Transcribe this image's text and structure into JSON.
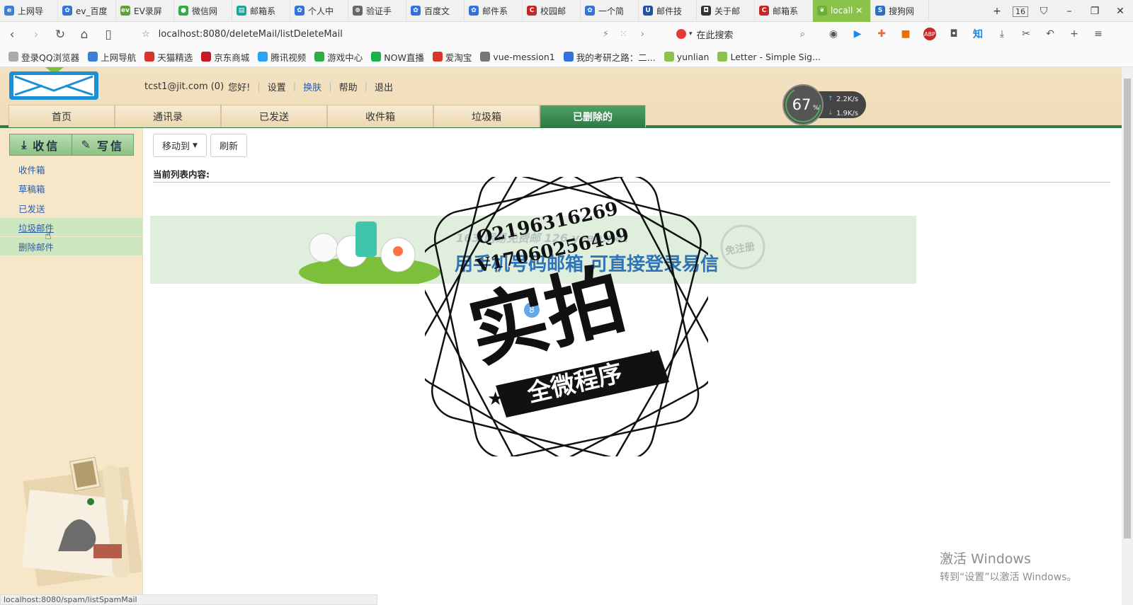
{
  "browser": {
    "tabs": [
      {
        "label": "上网导",
        "color": "#3b7fd8",
        "glyph": "e"
      },
      {
        "label": "ev_百度",
        "color": "#3273e0",
        "glyph": "✿"
      },
      {
        "label": "EV录屏",
        "color": "#5aa531",
        "glyph": "ev"
      },
      {
        "label": "微信网",
        "color": "#2dae45",
        "glyph": "●"
      },
      {
        "label": "邮箱系",
        "color": "#1aa59c",
        "glyph": "▤"
      },
      {
        "label": "个人中",
        "color": "#3273e0",
        "glyph": "✿"
      },
      {
        "label": "验证手",
        "color": "#666666",
        "glyph": "⊕"
      },
      {
        "label": "百度文",
        "color": "#3273e0",
        "glyph": "✿"
      },
      {
        "label": "邮件系",
        "color": "#3273e0",
        "glyph": "✿"
      },
      {
        "label": "校园邮",
        "color": "#c62828",
        "glyph": "C"
      },
      {
        "label": "一个简",
        "color": "#3273e0",
        "glyph": "✿"
      },
      {
        "label": "邮件技",
        "color": "#1f4fa8",
        "glyph": "U"
      },
      {
        "label": "关于邮",
        "color": "#333333",
        "glyph": "◘"
      },
      {
        "label": "邮箱系",
        "color": "#c62828",
        "glyph": "C"
      },
      {
        "label": "locall",
        "color": "#6bb036",
        "glyph": "❦",
        "active": true
      },
      {
        "label": "搜狗网",
        "color": "#2a70c9",
        "glyph": "S"
      }
    ],
    "tab_count": "16",
    "url": "localhost:8080/deleteMail/listDeleteMail",
    "search_placeholder": "在此搜索",
    "bookmarks": [
      {
        "label": "登录QQ浏览器",
        "color": "#aaaaaa"
      },
      {
        "label": "上网导航",
        "color": "#3b7fd8"
      },
      {
        "label": "天猫精选",
        "color": "#d9342b"
      },
      {
        "label": "京东商城",
        "color": "#c81623"
      },
      {
        "label": "腾讯视频",
        "color": "#2aa4f4"
      },
      {
        "label": "游戏中心",
        "color": "#2dae45"
      },
      {
        "label": "NOW直播",
        "color": "#19b24b"
      },
      {
        "label": "爱淘宝",
        "color": "#d9342b"
      },
      {
        "label": "vue-mession1",
        "color": "#777777"
      },
      {
        "label": "我的考研之路：二...",
        "color": "#3273e0"
      },
      {
        "label": "yunlian",
        "color": "#8bc34a"
      },
      {
        "label": "Letter - Simple Sig...",
        "color": "#8bc34a"
      }
    ],
    "status_url": "localhost:8080/spam/listSpamMail"
  },
  "header": {
    "user": "tcst1@jit.com (0)",
    "greeting": "您好!",
    "links": [
      "设置",
      "换肤",
      "帮助",
      "退出"
    ],
    "nav": [
      {
        "label": "首页"
      },
      {
        "label": "通讯录"
      },
      {
        "label": "已发送"
      },
      {
        "label": "收件箱"
      },
      {
        "label": "垃圾箱"
      },
      {
        "label": "已删除的",
        "active": true
      }
    ],
    "speed": {
      "percent": "67",
      "unit": "%",
      "up": "2.2",
      "down": "1.9",
      "rate_unit": "K/s"
    }
  },
  "sidebar": {
    "receive": "收信",
    "write": "写信",
    "items": [
      "收件箱",
      "草稿箱",
      "已发送",
      "垃圾邮件",
      "删除邮件"
    ]
  },
  "content": {
    "move_to": "移动到",
    "refresh": "刷新",
    "list_label": "当前列表内容:",
    "banner_text": "用手机号码邮箱  可直接登录易信",
    "banner_logos": "163 网易免费邮  126  yeah.net",
    "banner_badge": "免注册",
    "bubble_count": "8"
  },
  "windows": {
    "line1": "激活 Windows",
    "line2": "转到“设置”以激活 Windows。"
  },
  "watermark": {
    "line1": "Q2196316269",
    "line2": "V17060256499",
    "big": "实拍",
    "ribbon": "全微程序"
  }
}
